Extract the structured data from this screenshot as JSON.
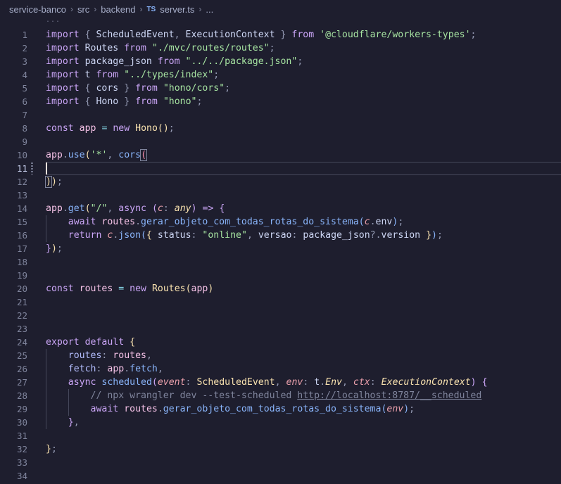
{
  "breadcrumb": {
    "items": [
      "service-banco",
      "src",
      "backend"
    ],
    "file_icon": "TS",
    "file": "server.ts",
    "ellipsis": "..."
  },
  "fold_hint": "...",
  "editor": {
    "current_line": 11,
    "lines": [
      {
        "num": "1",
        "tokens": [
          [
            "import",
            "kw"
          ],
          [
            " ",
            "plain"
          ],
          [
            "{",
            "punc"
          ],
          [
            " ScheduledEvent",
            "plain"
          ],
          [
            ",",
            "punc"
          ],
          [
            " ExecutionContext ",
            "plain"
          ],
          [
            "}",
            "punc"
          ],
          [
            " ",
            "plain"
          ],
          [
            "from",
            "kw"
          ],
          [
            " ",
            "plain"
          ],
          [
            "'@cloudflare/workers-types'",
            "str"
          ],
          [
            ";",
            "punc"
          ]
        ]
      },
      {
        "num": "2",
        "tokens": [
          [
            "import",
            "kw"
          ],
          [
            " Routes ",
            "plain"
          ],
          [
            "from",
            "kw"
          ],
          [
            " ",
            "plain"
          ],
          [
            "\"./mvc/routes/routes\"",
            "str"
          ],
          [
            ";",
            "punc"
          ]
        ]
      },
      {
        "num": "3",
        "tokens": [
          [
            "import",
            "kw"
          ],
          [
            " package_json ",
            "plain"
          ],
          [
            "from",
            "kw"
          ],
          [
            " ",
            "plain"
          ],
          [
            "\"../../package.json\"",
            "str"
          ],
          [
            ";",
            "punc"
          ]
        ]
      },
      {
        "num": "4",
        "tokens": [
          [
            "import",
            "kw"
          ],
          [
            " t ",
            "plain"
          ],
          [
            "from",
            "kw"
          ],
          [
            " ",
            "plain"
          ],
          [
            "\"../types/index\"",
            "str"
          ],
          [
            ";",
            "punc"
          ]
        ]
      },
      {
        "num": "5",
        "tokens": [
          [
            "import",
            "kw"
          ],
          [
            " ",
            "plain"
          ],
          [
            "{",
            "punc"
          ],
          [
            " cors ",
            "plain"
          ],
          [
            "}",
            "punc"
          ],
          [
            " ",
            "plain"
          ],
          [
            "from",
            "kw"
          ],
          [
            " ",
            "plain"
          ],
          [
            "\"hono/cors\"",
            "str"
          ],
          [
            ";",
            "punc"
          ]
        ]
      },
      {
        "num": "6",
        "tokens": [
          [
            "import",
            "kw"
          ],
          [
            " ",
            "plain"
          ],
          [
            "{",
            "punc"
          ],
          [
            " Hono ",
            "plain"
          ],
          [
            "}",
            "punc"
          ],
          [
            " ",
            "plain"
          ],
          [
            "from",
            "kw"
          ],
          [
            " ",
            "plain"
          ],
          [
            "\"hono\"",
            "str"
          ],
          [
            ";",
            "punc"
          ]
        ]
      },
      {
        "num": "7",
        "tokens": []
      },
      {
        "num": "8",
        "tokens": [
          [
            "const",
            "kw"
          ],
          [
            " ",
            "plain"
          ],
          [
            "app",
            "var"
          ],
          [
            " ",
            "plain"
          ],
          [
            "=",
            "op"
          ],
          [
            " ",
            "plain"
          ],
          [
            "new",
            "kw"
          ],
          [
            " ",
            "plain"
          ],
          [
            "Hono",
            "class"
          ],
          [
            "()",
            "brk1"
          ],
          [
            ";",
            "punc"
          ]
        ]
      },
      {
        "num": "9",
        "tokens": []
      },
      {
        "num": "10",
        "tokens": [
          [
            "app",
            "var"
          ],
          [
            ".",
            "punc"
          ],
          [
            "use",
            "fn"
          ],
          [
            "(",
            "brk1"
          ],
          [
            "'*'",
            "str"
          ],
          [
            ",",
            "punc"
          ],
          [
            " ",
            "plain"
          ],
          [
            "cors",
            "fn"
          ],
          [
            "(",
            "brkerr"
          ]
        ]
      },
      {
        "num": "11",
        "tokens": []
      },
      {
        "num": "12",
        "tokens": [
          [
            ")",
            "brk1"
          ],
          [
            ")",
            "brk1"
          ],
          [
            ";",
            "punc"
          ]
        ]
      },
      {
        "num": "13",
        "tokens": []
      },
      {
        "num": "14",
        "tokens": [
          [
            "app",
            "var"
          ],
          [
            ".",
            "punc"
          ],
          [
            "get",
            "fn"
          ],
          [
            "(",
            "brk1"
          ],
          [
            "\"/\"",
            "str"
          ],
          [
            ",",
            "punc"
          ],
          [
            " ",
            "plain"
          ],
          [
            "async",
            "kw"
          ],
          [
            " ",
            "plain"
          ],
          [
            "(",
            "brk2"
          ],
          [
            "c",
            "param"
          ],
          [
            ":",
            "punc"
          ],
          [
            " ",
            "plain"
          ],
          [
            "any",
            "type"
          ],
          [
            ")",
            "brk2"
          ],
          [
            " ",
            "plain"
          ],
          [
            "=>",
            "kw"
          ],
          [
            " ",
            "plain"
          ],
          [
            "{",
            "brk2"
          ]
        ]
      },
      {
        "num": "15",
        "indent": 1,
        "tokens": [
          [
            "    ",
            "plain"
          ],
          [
            "await",
            "kw"
          ],
          [
            " ",
            "plain"
          ],
          [
            "routes",
            "var"
          ],
          [
            ".",
            "punc"
          ],
          [
            "gerar_objeto_com_todas_rotas_do_sistema",
            "fn"
          ],
          [
            "(",
            "brk3"
          ],
          [
            "c",
            "param"
          ],
          [
            ".",
            "punc"
          ],
          [
            "env",
            "plain"
          ],
          [
            ")",
            "brk3"
          ],
          [
            ";",
            "punc"
          ]
        ]
      },
      {
        "num": "16",
        "indent": 1,
        "tokens": [
          [
            "    ",
            "plain"
          ],
          [
            "return",
            "kw"
          ],
          [
            " ",
            "plain"
          ],
          [
            "c",
            "param"
          ],
          [
            ".",
            "punc"
          ],
          [
            "json",
            "fn"
          ],
          [
            "(",
            "brk3"
          ],
          [
            "{",
            "brk1"
          ],
          [
            " status",
            "plain"
          ],
          [
            ":",
            "punc"
          ],
          [
            " ",
            "plain"
          ],
          [
            "\"online\"",
            "str"
          ],
          [
            ",",
            "punc"
          ],
          [
            " versao",
            "plain"
          ],
          [
            ":",
            "punc"
          ],
          [
            " package_json",
            "plain"
          ],
          [
            "?.",
            "punc"
          ],
          [
            "version ",
            "plain"
          ],
          [
            "}",
            "brk1"
          ],
          [
            ")",
            "brk3"
          ],
          [
            ";",
            "punc"
          ]
        ]
      },
      {
        "num": "17",
        "tokens": [
          [
            "}",
            "brk2"
          ],
          [
            ")",
            "brk1"
          ],
          [
            ";",
            "punc"
          ]
        ]
      },
      {
        "num": "18",
        "tokens": []
      },
      {
        "num": "19",
        "tokens": []
      },
      {
        "num": "20",
        "tokens": [
          [
            "const",
            "kw"
          ],
          [
            " ",
            "plain"
          ],
          [
            "routes",
            "var"
          ],
          [
            " ",
            "plain"
          ],
          [
            "=",
            "op"
          ],
          [
            " ",
            "plain"
          ],
          [
            "new",
            "kw"
          ],
          [
            " ",
            "plain"
          ],
          [
            "Routes",
            "class"
          ],
          [
            "(",
            "brk1"
          ],
          [
            "app",
            "var"
          ],
          [
            ")",
            "brk1"
          ]
        ]
      },
      {
        "num": "21",
        "tokens": []
      },
      {
        "num": "22",
        "tokens": []
      },
      {
        "num": "23",
        "tokens": []
      },
      {
        "num": "24",
        "tokens": [
          [
            "export",
            "kw"
          ],
          [
            " ",
            "plain"
          ],
          [
            "default",
            "kw"
          ],
          [
            " ",
            "plain"
          ],
          [
            "{",
            "brk1"
          ]
        ]
      },
      {
        "num": "25",
        "indent": 1,
        "tokens": [
          [
            "    ",
            "plain"
          ],
          [
            "routes",
            "prop"
          ],
          [
            ":",
            "punc"
          ],
          [
            " ",
            "plain"
          ],
          [
            "routes",
            "var"
          ],
          [
            ",",
            "punc"
          ]
        ]
      },
      {
        "num": "26",
        "indent": 1,
        "tokens": [
          [
            "    ",
            "plain"
          ],
          [
            "fetch",
            "prop"
          ],
          [
            ":",
            "punc"
          ],
          [
            " ",
            "plain"
          ],
          [
            "app",
            "var"
          ],
          [
            ".",
            "punc"
          ],
          [
            "fetch",
            "fn"
          ],
          [
            ",",
            "punc"
          ]
        ]
      },
      {
        "num": "27",
        "indent": 1,
        "tokens": [
          [
            "    ",
            "plain"
          ],
          [
            "async",
            "kw"
          ],
          [
            " ",
            "plain"
          ],
          [
            "scheduled",
            "fn"
          ],
          [
            "(",
            "brk2"
          ],
          [
            "event",
            "param"
          ],
          [
            ":",
            "punc"
          ],
          [
            " ",
            "plain"
          ],
          [
            "ScheduledEvent",
            "class"
          ],
          [
            ",",
            "punc"
          ],
          [
            " ",
            "plain"
          ],
          [
            "env",
            "param"
          ],
          [
            ":",
            "punc"
          ],
          [
            " ",
            "plain"
          ],
          [
            "t",
            "plain"
          ],
          [
            ".",
            "punc"
          ],
          [
            "Env",
            "type"
          ],
          [
            ",",
            "punc"
          ],
          [
            " ",
            "plain"
          ],
          [
            "ctx",
            "param"
          ],
          [
            ":",
            "punc"
          ],
          [
            " ",
            "plain"
          ],
          [
            "ExecutionContext",
            "type"
          ],
          [
            ")",
            "brk2"
          ],
          [
            " ",
            "plain"
          ],
          [
            "{",
            "brk2"
          ]
        ]
      },
      {
        "num": "28",
        "indent": 2,
        "tokens": [
          [
            "        ",
            "plain"
          ],
          [
            "// npx wrangler dev --test-scheduled ",
            "comment"
          ],
          [
            "http://localhost:8787/__scheduled",
            "link"
          ]
        ]
      },
      {
        "num": "29",
        "indent": 2,
        "tokens": [
          [
            "        ",
            "plain"
          ],
          [
            "await",
            "kw"
          ],
          [
            " ",
            "plain"
          ],
          [
            "routes",
            "var"
          ],
          [
            ".",
            "punc"
          ],
          [
            "gerar_objeto_com_todas_rotas_do_sistema",
            "fn"
          ],
          [
            "(",
            "brk3"
          ],
          [
            "env",
            "param"
          ],
          [
            ")",
            "brk3"
          ],
          [
            ";",
            "punc"
          ]
        ]
      },
      {
        "num": "30",
        "indent": 1,
        "tokens": [
          [
            "    ",
            "plain"
          ],
          [
            "}",
            "brk2"
          ],
          [
            ",",
            "punc"
          ]
        ]
      },
      {
        "num": "31",
        "tokens": []
      },
      {
        "num": "32",
        "tokens": [
          [
            "}",
            "brk1"
          ],
          [
            ";",
            "punc"
          ]
        ]
      },
      {
        "num": "33",
        "tokens": []
      },
      {
        "num": "34",
        "tokens": []
      }
    ]
  }
}
